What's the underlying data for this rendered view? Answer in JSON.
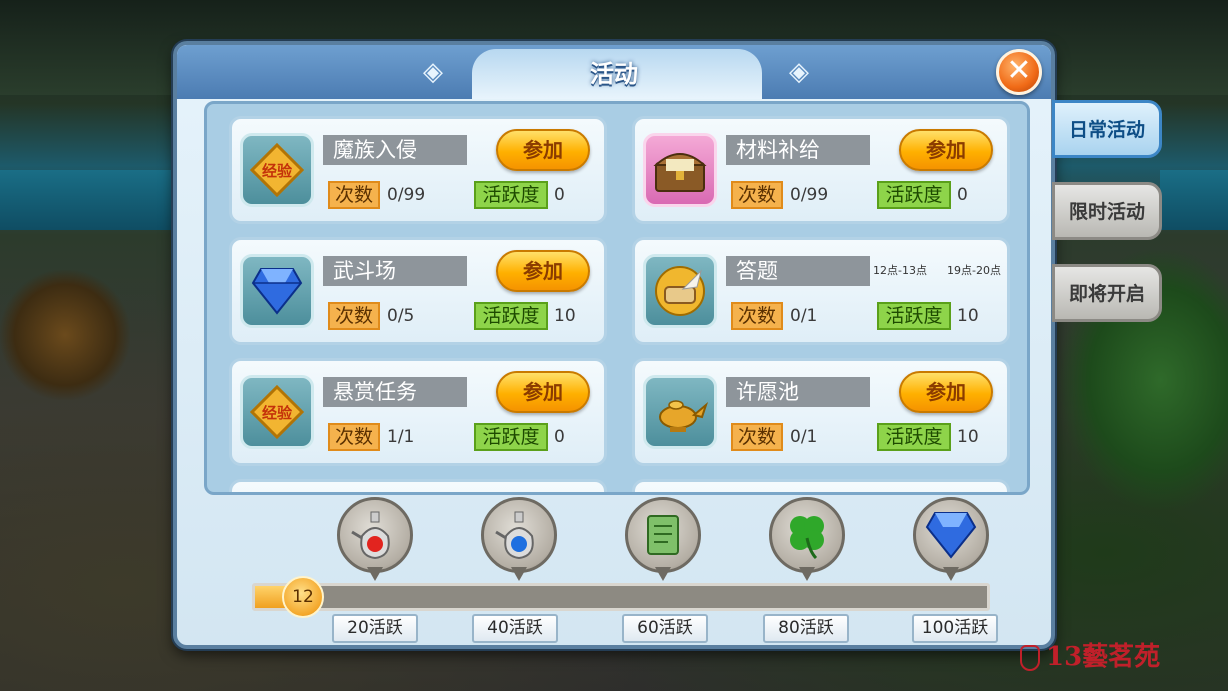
{
  "window": {
    "title": "活动",
    "close_symbol": "✕"
  },
  "activities": [
    {
      "name": "魔族入侵",
      "icon": "exp-badge-icon",
      "icon_text": "经验",
      "join_label": "参加",
      "times_label": "次数",
      "times": "0/99",
      "activity_label": "活跃度",
      "activity": "0"
    },
    {
      "name": "材料补给",
      "icon": "treasure-chest-icon",
      "join_label": "参加",
      "times_label": "次数",
      "times": "0/99",
      "activity_label": "活跃度",
      "activity": "0"
    },
    {
      "name": "武斗场",
      "icon": "blue-diamond-icon",
      "join_label": "参加",
      "times_label": "次数",
      "times": "0/5",
      "activity_label": "活跃度",
      "activity": "10"
    },
    {
      "name": "答题",
      "icon": "scroll-quill-icon",
      "time_slots": [
        "12点-13点",
        "19点-20点"
      ],
      "times_label": "次数",
      "times": "0/1",
      "activity_label": "活跃度",
      "activity": "10"
    },
    {
      "name": "悬赏任务",
      "icon": "exp-badge-icon",
      "icon_text": "经验",
      "join_label": "参加",
      "times_label": "次数",
      "times": "1/1",
      "activity_label": "活跃度",
      "activity": "0"
    },
    {
      "name": "许愿池",
      "icon": "magic-lamp-icon",
      "join_label": "参加",
      "times_label": "次数",
      "times": "0/1",
      "activity_label": "活跃度",
      "activity": "10"
    }
  ],
  "progress": {
    "current": "12",
    "current_value": 12,
    "max_value": 100,
    "milestones": [
      {
        "label": "20活跃",
        "value": 20,
        "reward_icon": "red-potion-icon"
      },
      {
        "label": "40活跃",
        "value": 40,
        "reward_icon": "blue-potion-icon"
      },
      {
        "label": "60活跃",
        "value": 60,
        "reward_icon": "green-scroll-icon"
      },
      {
        "label": "80活跃",
        "value": 80,
        "reward_icon": "four-leaf-clover-icon"
      },
      {
        "label": "100活跃",
        "value": 100,
        "reward_icon": "blue-diamond-icon"
      }
    ]
  },
  "side_tabs": [
    {
      "label": "日常活动",
      "active": true
    },
    {
      "label": "限时活动",
      "active": false
    },
    {
      "label": "即将开启",
      "active": false
    }
  ],
  "watermark": "13藝茗苑",
  "colors": {
    "join_button": "#ffb000",
    "times_tag": "#f5b24d",
    "activity_tag": "#8ed44a",
    "progress_fill": "#f0a020",
    "close_button": "#f06a16"
  }
}
